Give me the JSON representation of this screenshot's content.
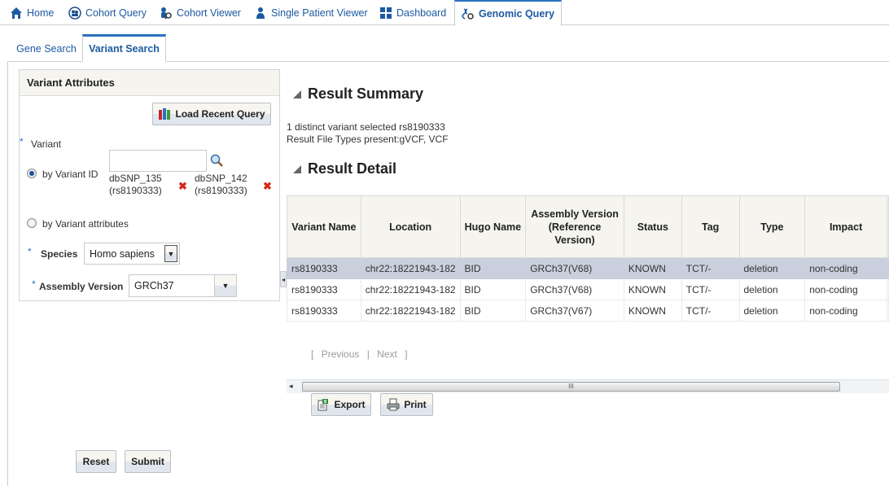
{
  "top_nav": {
    "tabs": [
      {
        "label": "Home",
        "icon": "home-icon"
      },
      {
        "label": "Cohort Query",
        "icon": "cohort-query-icon"
      },
      {
        "label": "Cohort Viewer",
        "icon": "cohort-viewer-icon"
      },
      {
        "label": "Single Patient Viewer",
        "icon": "patient-icon"
      },
      {
        "label": "Dashboard",
        "icon": "dashboard-icon"
      },
      {
        "label": "Genomic Query",
        "icon": "genomic-icon",
        "active": true
      }
    ]
  },
  "sub_tabs": [
    {
      "label": "Gene Search"
    },
    {
      "label": "Variant Search",
      "active": true
    }
  ],
  "variant_attributes": {
    "title": "Variant Attributes",
    "load_recent_query": "Load Recent Query",
    "variant_label": "Variant",
    "by_variant_id_label": "by Variant ID",
    "variant_id_value": "",
    "selected_variants": [
      {
        "source": "dbSNP_135",
        "id": "(rs8190333)"
      },
      {
        "source": "dbSNP_142",
        "id": "(rs8190333)"
      }
    ],
    "by_variant_attributes_label": "by Variant attributes",
    "species_label": "Species",
    "species_value": "Homo sapiens",
    "assembly_label": "Assembly Version",
    "assembly_value": "GRCh37",
    "required_marker": "*"
  },
  "buttons": {
    "reset": "Reset",
    "submit": "Submit",
    "export": "Export",
    "print": "Print"
  },
  "result_summary": {
    "title": "Result Summary",
    "line1": "1 distinct variant selected rs8190333",
    "line2": "Result File Types present:gVCF, VCF"
  },
  "result_detail": {
    "title": "Result Detail",
    "columns": [
      "Variant Name",
      "Location",
      "Hugo Name",
      "Assembly Version (Reference Version)",
      "Status",
      "Tag",
      "Type",
      "Impact"
    ],
    "rows": [
      [
        "rs8190333",
        "chr22:18221943-182",
        "BID",
        "GRCh37(V68)",
        "KNOWN",
        "TCT/-",
        "deletion",
        "non-coding"
      ],
      [
        "rs8190333",
        "chr22:18221943-182",
        "BID",
        "GRCh37(V68)",
        "KNOWN",
        "TCT/-",
        "deletion",
        "non-coding"
      ],
      [
        "rs8190333",
        "chr22:18221943-182",
        "BID",
        "GRCh37(V67)",
        "KNOWN",
        "TCT/-",
        "deletion",
        "non-coding"
      ]
    ],
    "selected_row": 0
  },
  "pager": {
    "open": "[",
    "previous": "Previous",
    "sep": "|",
    "next": "Next",
    "close": "]"
  },
  "scrollbar_grip": "III",
  "colors": {
    "accent": "#2a71c0",
    "link": "#1c5aa0",
    "selected_row": "#c9cfdd",
    "header_bg": "#f5f4ee",
    "delete": "#d42a1e"
  }
}
